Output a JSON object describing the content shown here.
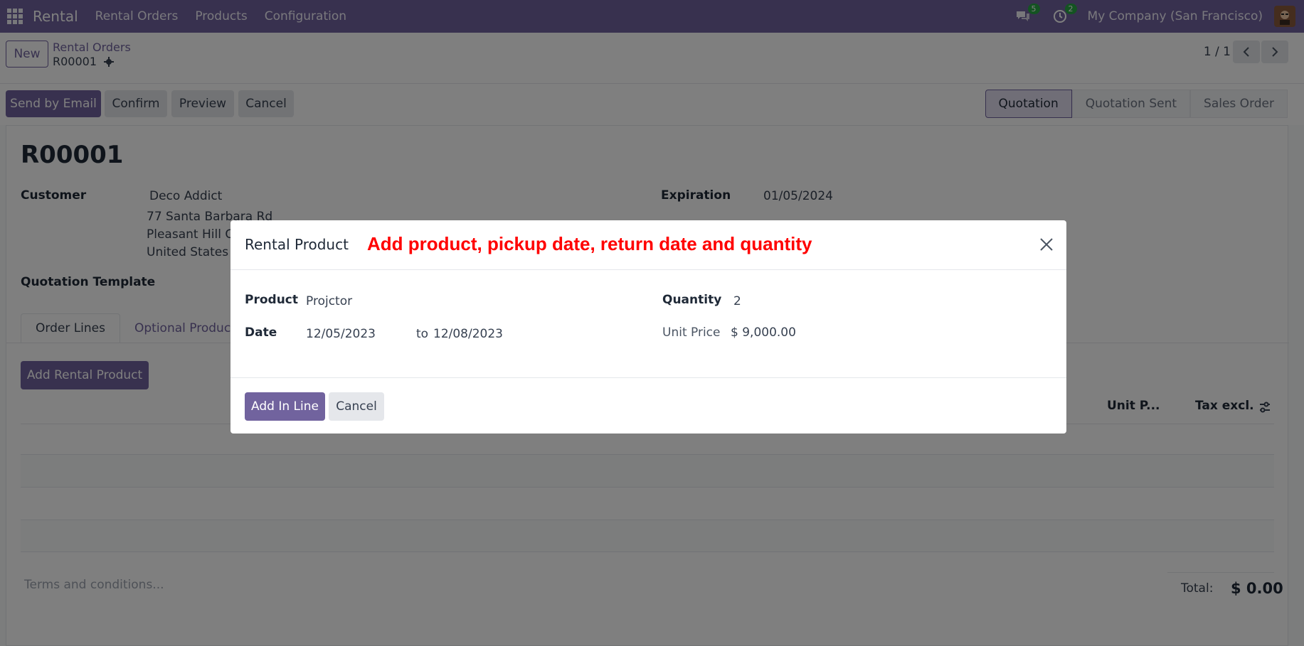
{
  "navbar": {
    "brand": "Rental",
    "menu": [
      "Rental Orders",
      "Products",
      "Configuration"
    ],
    "messages_badge": "5",
    "activities_badge": "2",
    "company": "My Company (San Francisco)"
  },
  "control": {
    "new_label": "New",
    "breadcrumb_parent": "Rental Orders",
    "breadcrumb_current": "R00001",
    "pager": "1 / 1"
  },
  "statusbar": {
    "buttons": [
      "Send by Email",
      "Confirm",
      "Preview",
      "Cancel"
    ],
    "stages": [
      "Quotation",
      "Quotation Sent",
      "Sales Order"
    ],
    "active_stage": "Quotation"
  },
  "sheet": {
    "title": "R00001",
    "customer_label": "Customer",
    "customer_name": "Deco Addict",
    "address_line1": "77 Santa Barbara Rd",
    "address_line2": "Pleasant Hill CA",
    "address_line3": "United States –",
    "expiration_label": "Expiration",
    "expiration_value": "01/05/2024",
    "quotation_template_label": "Quotation Template",
    "tabs": [
      "Order Lines",
      "Optional Products"
    ],
    "add_rental_label": "Add Rental Product",
    "col_unit_price": "Unit P...",
    "col_tax_excl": "Tax excl.",
    "terms_placeholder": "Terms and conditions...",
    "total_label": "Total:",
    "total_value": "$ 0.00"
  },
  "modal": {
    "title": "Rental Product",
    "annotation": "Add product, pickup date, return date and quantity",
    "product_label": "Product",
    "product_value": "Projctor",
    "date_label": "Date",
    "date_from": "12/05/2023",
    "date_to_label": "to",
    "date_to": "12/08/2023",
    "quantity_label": "Quantity",
    "quantity_value": "2",
    "unit_price_label": "Unit Price",
    "unit_price_value": "$ 9,000.00",
    "add_button": "Add In Line",
    "cancel_button": "Cancel"
  },
  "colors": {
    "brand": "#71639e",
    "annotation": "#ff0000",
    "badge": "#28a745"
  },
  "icons": [
    "apps-grid-icon",
    "chat-icon",
    "clock-icon",
    "gear-icon",
    "chevron-left-icon",
    "chevron-right-icon",
    "close-icon",
    "settings-sliders-icon"
  ]
}
